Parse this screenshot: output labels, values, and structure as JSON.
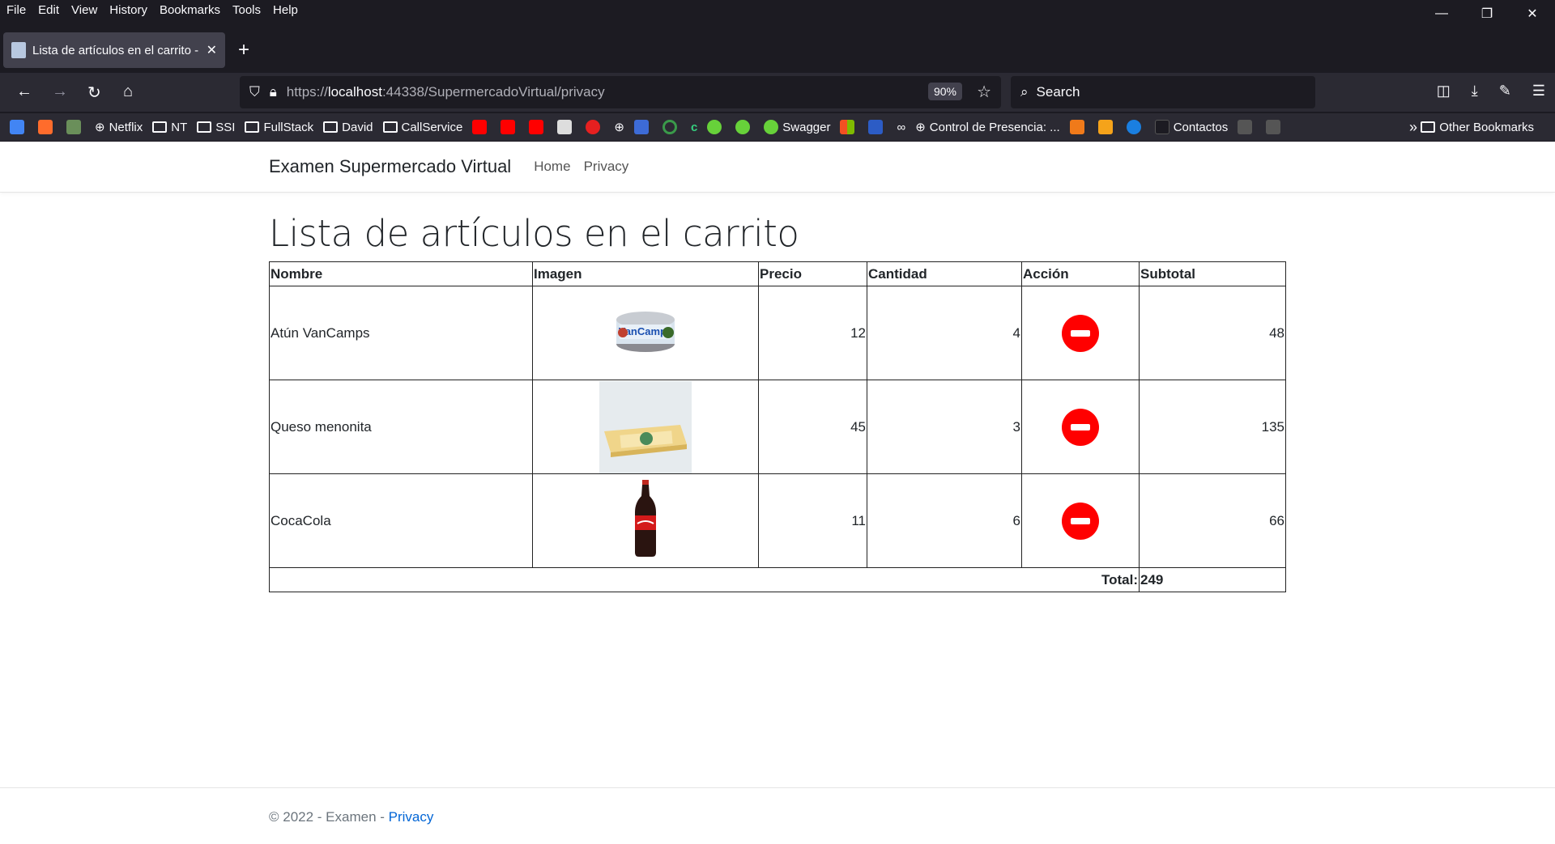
{
  "browser": {
    "menu": [
      "File",
      "Edit",
      "View",
      "History",
      "Bookmarks",
      "Tools",
      "Help"
    ],
    "tab_title": "Lista de artículos en el carrito - ",
    "url_proto": "https://",
    "url_host": "localhost",
    "url_rest": ":44338/SupermercadoVirtual/privacy",
    "zoom": "90%",
    "search_placeholder": "Search",
    "bookmarks": [
      "Netflix",
      "NT",
      "SSI",
      "FullStack",
      "David",
      "CallService",
      "Swagger",
      "Control de Presencia: ...",
      "Contactos"
    ],
    "other_bookmarks": "Other Bookmarks"
  },
  "site": {
    "brand": "Examen Supermercado Virtual",
    "nav": [
      "Home",
      "Privacy"
    ]
  },
  "main": {
    "title": "Lista de artículos en el carrito",
    "columns": [
      "Nombre",
      "Imagen",
      "Precio",
      "Cantidad",
      "Acción",
      "Subtotal"
    ],
    "rows": [
      {
        "nombre": "Atún VanCamps",
        "imagen": "tuna-can-image",
        "precio": "12",
        "cantidad": "4",
        "subtotal": "48"
      },
      {
        "nombre": "Queso menonita",
        "imagen": "cheese-image",
        "precio": "45",
        "cantidad": "3",
        "subtotal": "135"
      },
      {
        "nombre": "CocaCola",
        "imagen": "cola-bottle-image",
        "precio": "11",
        "cantidad": "6",
        "subtotal": "66"
      }
    ],
    "total_label": "Total:",
    "total_value": "249"
  },
  "footer": {
    "text": "© 2022 - Examen - ",
    "link": "Privacy"
  },
  "colors": {
    "remove_button": "#ff0000",
    "footer_link": "#0366d6"
  }
}
